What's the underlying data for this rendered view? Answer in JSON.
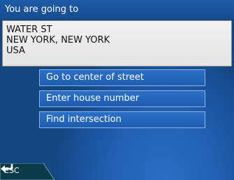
{
  "header": {
    "title": "You are going to"
  },
  "address": {
    "line1": "WATER ST",
    "line2": "NEW YORK, NEW YORK",
    "line3": "USA"
  },
  "options": {
    "center_label": "Go to center of street",
    "house_label": "Enter house number",
    "intersection_label": "Find intersection"
  },
  "footer": {
    "esc_label": "ESC"
  },
  "colors": {
    "background": "#1a529c",
    "button": "#1f5eb1",
    "button_border": "#8fb3e4",
    "esc_tab": "#0c3a4a"
  }
}
